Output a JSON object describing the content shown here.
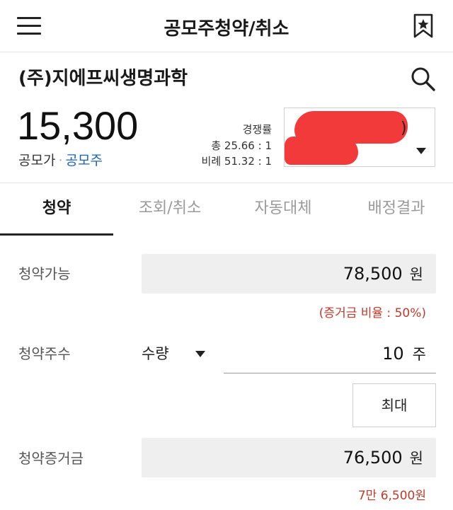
{
  "header": {
    "title": "공모주청약/취소"
  },
  "stock": {
    "name": "(주)지에프씨생명과학",
    "price": "15,300",
    "price_label": "공모가",
    "price_link": "공모주"
  },
  "competition": {
    "label": "경쟁률",
    "total": "총 25.66 : 1",
    "proportional": "비례 51.32 : 1"
  },
  "account": {
    "value_suffix": ")"
  },
  "tabs": [
    {
      "label": "청약",
      "active": true
    },
    {
      "label": "조회/취소",
      "active": false
    },
    {
      "label": "자동대체",
      "active": false
    },
    {
      "label": "배정결과",
      "active": false
    }
  ],
  "form": {
    "available": {
      "label": "청약가능",
      "value": "78,500",
      "unit": "원",
      "note": "(증거금 비율 : 50%)"
    },
    "shares": {
      "label": "청약주수",
      "select_value": "수량",
      "value": "10",
      "unit": "주",
      "max_label": "최대"
    },
    "deposit": {
      "label": "청약증거금",
      "value": "76,500",
      "unit": "원",
      "note": "7만 6,500원"
    }
  },
  "colors": {
    "accent_red": "#c0392b",
    "link_blue": "#1f62b9",
    "redaction": "#f23a3a"
  }
}
